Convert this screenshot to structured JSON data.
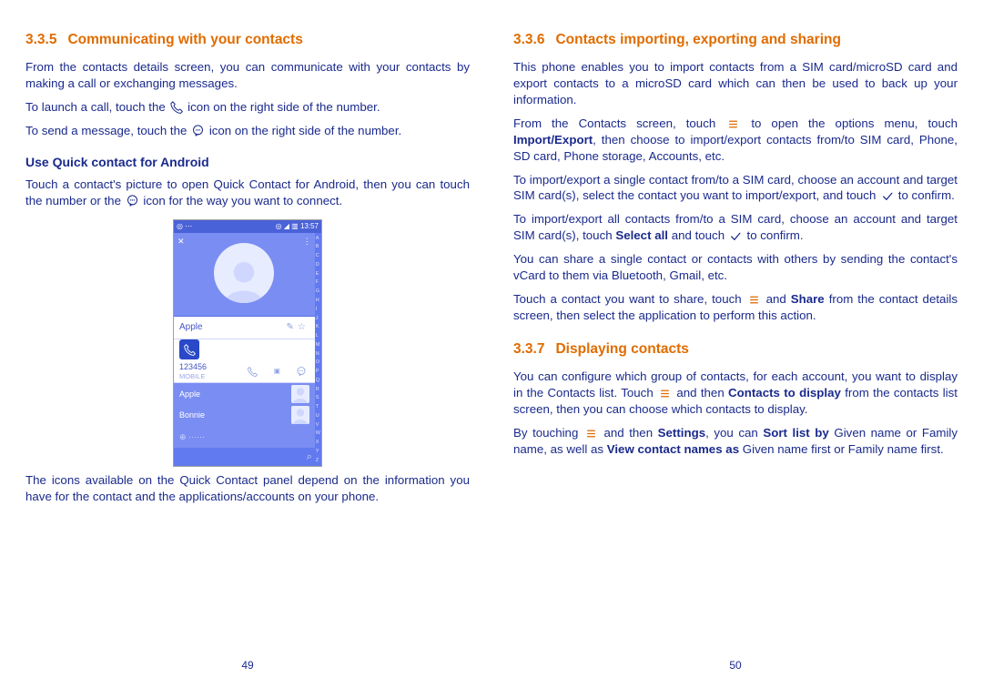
{
  "left": {
    "section_num": "3.3.5",
    "section_title": "Communicating with your contacts",
    "p1": "From the contacts details screen, you can communicate with your contacts by making a call or exchanging messages.",
    "p2a": "To launch a call, touch the ",
    "p2b": " icon on the right side of the number.",
    "p3a": "To send a message, touch the ",
    "p3b": " icon on the right side of the number.",
    "sub1": "Use Quick contact for Android",
    "p4a": "Touch a contact's picture to open Quick Contact for Android, then you can touch the number or the ",
    "p4b": " icon for the way you want to connect.",
    "p5": "The icons available on the Quick Contact panel depend on the information you have for the contact and the applications/accounts on your phone.",
    "pageno": "49"
  },
  "right": {
    "s1_num": "3.3.6",
    "s1_title": "Contacts importing, exporting and sharing",
    "p1": "This phone enables you to import contacts from a SIM card/microSD card and export contacts to a microSD card which can then be used to back up your information.",
    "p2a": "From the Contacts screen, touch ",
    "p2b": " to open the options menu, touch ",
    "p2c": "Import/Export",
    "p2d": ", then choose to import/export contacts from/to SIM card, Phone, SD card, Phone storage, Accounts, etc.",
    "p3a": "To import/export a single contact from/to a SIM card, choose an account and target SIM card(s), select the contact you want to import/export, and touch ",
    "p3b": " to confirm.",
    "p4a": "To import/export all contacts from/to a SIM card, choose an account and target SIM card(s), touch ",
    "p4b": "Select all",
    "p4c": " and touch ",
    "p4d": " to confirm.",
    "p5": "You can share a single contact or contacts with others by sending the contact's vCard to them via Bluetooth, Gmail, etc.",
    "p6a": "Touch a contact you want to share, touch ",
    "p6b": " and ",
    "p6c": "Share",
    "p6d": " from the contact details screen, then select the application to perform this action.",
    "s2_num": "3.3.7",
    "s2_title": "Displaying contacts",
    "p7a": "You can configure which group of contacts, for each account, you want to display in the Contacts list. Touch ",
    "p7b": " and then ",
    "p7c": "Contacts to display",
    "p7d": " from the contacts list screen, then you can choose which contacts to display.",
    "p8a": "By touching ",
    "p8b": " and then ",
    "p8c": "Settings",
    "p8d": ", you can ",
    "p8e": "Sort list by",
    "p8f": " Given name or Family name, as well as ",
    "p8g": "View contact names as",
    "p8h": " Given name first or Family name first.",
    "pageno": "50"
  },
  "phone": {
    "time": "13:57",
    "signal": "◎ ◢ ▥",
    "close": "✕",
    "menu": "⋮",
    "edit_icon": "✎",
    "star_icon": "☆",
    "name": "Apple",
    "num": "123456",
    "num_type": "MOBILE",
    "c2": "Apple",
    "c3": "Bonnie",
    "add": "⊕ ······"
  },
  "icons": {
    "call_icon": "call-icon",
    "message_icon": "message-icon",
    "menu_icon": "menu-icon",
    "check_icon": "check-icon"
  }
}
